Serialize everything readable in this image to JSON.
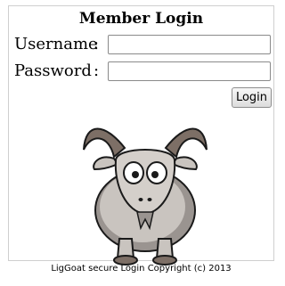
{
  "login": {
    "title": "Member Login",
    "username_label": "Username",
    "password_label": "Password",
    "separator": ":",
    "username_value": "",
    "password_value": "",
    "submit_label": "Login"
  },
  "mascot": {
    "icon": "goat-illustration",
    "colors": {
      "body": "#c9c4bf",
      "shadow": "#9a9490",
      "horns": "#7d6f66",
      "outline": "#1a1a1a"
    }
  },
  "footer": {
    "copyright": "LigGoat secure Login Copyright (c) 2013"
  }
}
